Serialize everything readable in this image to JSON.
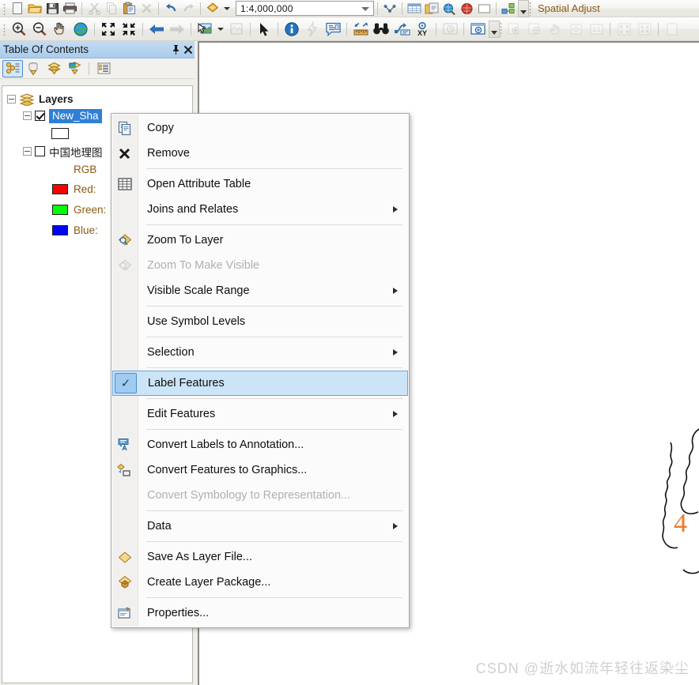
{
  "toolbars": {
    "standard": {
      "items": [
        {
          "name": "new-map-button",
          "icon": "new-document-icon",
          "label": "New",
          "disabled": false
        },
        {
          "name": "open-button",
          "icon": "open-folder-icon",
          "label": "Open",
          "disabled": false
        },
        {
          "name": "save-button",
          "icon": "save-floppy-icon",
          "label": "Save",
          "disabled": false
        },
        {
          "name": "print-button",
          "icon": "printer-icon",
          "label": "Print",
          "disabled": false
        },
        {
          "name": "cut-button",
          "icon": "scissors-icon",
          "label": "Cut",
          "disabled": true
        },
        {
          "name": "copy-button",
          "icon": "copy-pages-icon",
          "label": "Copy",
          "disabled": true
        },
        {
          "name": "paste-button",
          "icon": "paste-clipboard-icon",
          "label": "Paste",
          "disabled": false
        },
        {
          "name": "delete-button",
          "icon": "delete-x-icon",
          "label": "Delete",
          "disabled": true
        },
        {
          "name": "undo-button",
          "icon": "undo-arrow-icon",
          "label": "Undo",
          "disabled": false
        },
        {
          "name": "redo-button",
          "icon": "redo-arrow-icon",
          "label": "Redo",
          "disabled": true
        },
        {
          "name": "toolbox-button",
          "icon": "arctoolbox-icon",
          "label": "ArcToolbox",
          "disabled": false
        }
      ],
      "scale": {
        "value": "1:4,000,000",
        "placeholder": "Map Scale"
      },
      "right_items": [
        {
          "name": "editor-toolbar-button",
          "icon": "editor-toolbar-icon",
          "label": "Editor Toolbar",
          "disabled": false
        },
        {
          "name": "table-window-button",
          "icon": "table-window-icon",
          "label": "Table Window",
          "disabled": false
        },
        {
          "name": "catalog-button",
          "icon": "catalog-icon",
          "label": "Catalog",
          "disabled": false
        },
        {
          "name": "search-window-button",
          "icon": "search-globe-icon",
          "label": "Search",
          "disabled": false
        },
        {
          "name": "arcgis-online-button",
          "icon": "arcglobe-red-icon",
          "label": "ArcGIS Online",
          "disabled": false
        },
        {
          "name": "python-window-button",
          "icon": "python-window-icon",
          "label": "Python",
          "disabled": false
        },
        {
          "name": "model-builder-button",
          "icon": "modelbuilder-icon",
          "label": "ModelBuilder",
          "disabled": false
        }
      ],
      "extension_label": "Spatial Adjust"
    },
    "tools": {
      "items": [
        {
          "name": "zoom-in-button",
          "icon": "zoom-in-magnifier-icon",
          "label": "Zoom In",
          "disabled": false
        },
        {
          "name": "zoom-out-button",
          "icon": "zoom-out-magnifier-icon",
          "label": "Zoom Out",
          "disabled": false
        },
        {
          "name": "pan-button",
          "icon": "pan-hand-icon",
          "label": "Pan",
          "disabled": false
        },
        {
          "name": "full-extent-button",
          "icon": "globe-full-extent-icon",
          "label": "Full Extent",
          "disabled": false
        },
        {
          "name": "fixed-zoom-in-button",
          "icon": "fixed-zoom-in-icon",
          "label": "Fixed Zoom In",
          "disabled": false
        },
        {
          "name": "fixed-zoom-out-button",
          "icon": "fixed-zoom-out-icon",
          "label": "Fixed Zoom Out",
          "disabled": false
        },
        {
          "name": "go-back-extent-button",
          "icon": "back-arrow-icon",
          "label": "Go Back To Previous Extent",
          "disabled": false
        },
        {
          "name": "go-forward-extent-button",
          "icon": "forward-arrow-icon",
          "label": "Go To Next Extent",
          "disabled": true
        },
        {
          "name": "select-features-button",
          "icon": "select-features-icon",
          "label": "Select Features",
          "disabled": false
        },
        {
          "name": "clear-selection-button",
          "icon": "clear-selection-icon",
          "label": "Clear Selected Features",
          "disabled": true
        },
        {
          "name": "select-elements-button",
          "icon": "cursor-arrow-icon",
          "label": "Select Elements",
          "disabled": false
        },
        {
          "name": "identify-button",
          "icon": "identify-info-icon",
          "label": "Identify",
          "disabled": false
        },
        {
          "name": "hyperlink-button",
          "icon": "hyperlink-lightning-icon",
          "label": "Hyperlink",
          "disabled": true
        },
        {
          "name": "html-popup-button",
          "icon": "html-popup-icon",
          "label": "HTML Popup",
          "disabled": false
        },
        {
          "name": "measure-button",
          "icon": "measure-ruler-icon",
          "label": "Measure",
          "disabled": false
        },
        {
          "name": "find-button",
          "icon": "binoculars-find-icon",
          "label": "Find",
          "disabled": false
        },
        {
          "name": "find-route-button",
          "icon": "find-route-icon",
          "label": "Find Route",
          "disabled": false
        },
        {
          "name": "go-to-xy-button",
          "icon": "go-to-xy-icon",
          "label": "Go To XY",
          "disabled": false
        },
        {
          "name": "time-slider-button",
          "icon": "time-slider-icon",
          "label": "Time Slider",
          "disabled": true
        },
        {
          "name": "create-viewer-window-button",
          "icon": "viewer-window-icon",
          "label": "Create Viewer Window",
          "disabled": false
        }
      ],
      "layout_items": [
        {
          "name": "layout-zoom-in-button",
          "icon": "layout-zoom-in-icon",
          "label": "Zoom In",
          "disabled": true
        },
        {
          "name": "layout-zoom-out-button",
          "icon": "layout-zoom-out-icon",
          "label": "Zoom Out",
          "disabled": true
        },
        {
          "name": "layout-pan-button",
          "icon": "layout-pan-icon",
          "label": "Pan",
          "disabled": true
        },
        {
          "name": "layout-full-extent-button",
          "icon": "layout-full-extent-icon",
          "label": "Zoom Whole Page",
          "disabled": true
        },
        {
          "name": "layout-1-to-1-button",
          "icon": "layout-one-to-one-icon",
          "label": "Zoom To 100%",
          "disabled": true
        },
        {
          "name": "layout-fixed-zoom-in-button",
          "icon": "layout-fixed-zoom-in-icon",
          "label": "Fixed Zoom In",
          "disabled": true
        },
        {
          "name": "layout-fixed-zoom-out-button",
          "icon": "layout-fixed-zoom-out-icon",
          "label": "Fixed Zoom Out",
          "disabled": true
        },
        {
          "name": "layout-extra-button",
          "icon": "layout-extra-icon",
          "label": "Go Back To Extent",
          "disabled": true
        }
      ]
    }
  },
  "toc": {
    "title": "Table Of Contents",
    "pin_icon": "pin-icon",
    "close_icon": "close-icon",
    "tools": [
      {
        "name": "list-by-drawing-order-button",
        "icon": "list-by-drawing-order-icon",
        "label": "List By Drawing Order",
        "selected": true
      },
      {
        "name": "list-by-source-button",
        "icon": "list-by-source-icon",
        "label": "List By Source",
        "selected": false
      },
      {
        "name": "list-by-visibility-button",
        "icon": "list-by-visibility-icon",
        "label": "List By Visibility",
        "selected": false
      },
      {
        "name": "list-by-selection-button",
        "icon": "list-by-selection-icon",
        "label": "List By Selection",
        "selected": false
      },
      {
        "name": "toc-options-button",
        "icon": "options-list-icon",
        "label": "Options",
        "selected": false
      }
    ],
    "tree": {
      "root": {
        "label": "Layers",
        "expanded": true
      },
      "layers": [
        {
          "label": "New_Sha",
          "checked": true,
          "expanded": true,
          "selected": true,
          "symbol": "empty-polygon-swatch"
        },
        {
          "label": "中国地理图",
          "checked": false,
          "expanded": true,
          "symbol": "rgb-raster"
        }
      ],
      "raster_bands": {
        "header": "RGB",
        "bands": [
          {
            "label": "Red:",
            "color": "#ff0000"
          },
          {
            "label": "Green:",
            "color": "#00ff00"
          },
          {
            "label": "Blue:",
            "color": "#0000ff"
          }
        ]
      }
    }
  },
  "context_menu": {
    "items": [
      {
        "label": "Copy",
        "icon": "copy-pages-icon",
        "type": "item",
        "disabled": false,
        "checked": false,
        "submenu": false
      },
      {
        "label": "Remove",
        "icon": "remove-x-icon",
        "type": "item",
        "disabled": false,
        "checked": false,
        "submenu": false
      },
      {
        "type": "separator"
      },
      {
        "label": "Open Attribute Table",
        "icon": "attribute-table-icon",
        "type": "item",
        "disabled": false,
        "checked": false,
        "submenu": false
      },
      {
        "label": "Joins and Relates",
        "icon": "none",
        "type": "item",
        "disabled": false,
        "checked": false,
        "submenu": true
      },
      {
        "type": "separator"
      },
      {
        "label": "Zoom To Layer",
        "icon": "zoom-to-layer-icon",
        "type": "item",
        "disabled": false,
        "checked": false,
        "submenu": false
      },
      {
        "label": "Zoom To Make Visible",
        "icon": "zoom-make-visible-icon",
        "type": "item",
        "disabled": true,
        "checked": false,
        "submenu": false
      },
      {
        "label": "Visible Scale Range",
        "icon": "none",
        "type": "item",
        "disabled": false,
        "checked": false,
        "submenu": true
      },
      {
        "type": "separator"
      },
      {
        "label": "Use Symbol Levels",
        "icon": "none",
        "type": "item",
        "disabled": false,
        "checked": false,
        "submenu": false
      },
      {
        "type": "separator"
      },
      {
        "label": "Selection",
        "icon": "none",
        "type": "item",
        "disabled": false,
        "checked": false,
        "submenu": true
      },
      {
        "type": "separator"
      },
      {
        "label": "Label Features",
        "icon": "checkmark-icon",
        "type": "item",
        "disabled": false,
        "checked": true,
        "highlight": true,
        "submenu": false
      },
      {
        "type": "separator"
      },
      {
        "label": "Edit Features",
        "icon": "none",
        "type": "item",
        "disabled": false,
        "checked": false,
        "submenu": true
      },
      {
        "type": "separator"
      },
      {
        "label": "Convert Labels to Annotation...",
        "icon": "convert-labels-annotation-icon",
        "type": "item",
        "disabled": false,
        "checked": false,
        "submenu": false
      },
      {
        "label": "Convert Features to Graphics...",
        "icon": "convert-features-graphics-icon",
        "type": "item",
        "disabled": false,
        "checked": false,
        "submenu": false
      },
      {
        "label": "Convert Symbology to Representation...",
        "icon": "none",
        "type": "item",
        "disabled": true,
        "checked": false,
        "submenu": false
      },
      {
        "type": "separator"
      },
      {
        "label": "Data",
        "icon": "none",
        "type": "item",
        "disabled": false,
        "checked": false,
        "submenu": true
      },
      {
        "type": "separator"
      },
      {
        "label": "Save As Layer File...",
        "icon": "layer-file-icon",
        "type": "item",
        "disabled": false,
        "checked": false,
        "submenu": false
      },
      {
        "label": "Create Layer Package...",
        "icon": "layer-package-icon",
        "type": "item",
        "disabled": false,
        "checked": false,
        "submenu": false
      },
      {
        "type": "separator"
      },
      {
        "label": "Properties...",
        "icon": "properties-icon",
        "type": "item",
        "disabled": false,
        "checked": false,
        "submenu": false
      }
    ]
  },
  "map": {
    "feature_label": "4",
    "feature_label_color": "#f07828",
    "watermark": "CSDN @逝水如流年轻往返染尘"
  }
}
